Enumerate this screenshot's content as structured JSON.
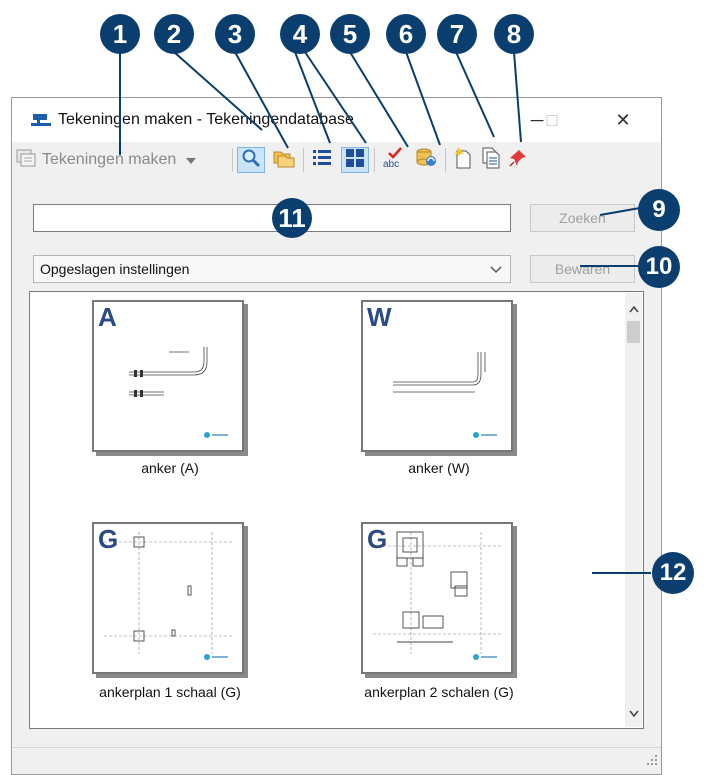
{
  "callouts": [
    "1",
    "2",
    "3",
    "4",
    "5",
    "6",
    "7",
    "8",
    "9",
    "10",
    "11",
    "12"
  ],
  "window": {
    "title": "Tekeningen maken - Tekeningendatabase",
    "minimize_glyph": "─",
    "maximize_glyph": "□",
    "close_glyph": "✕"
  },
  "toolbar": {
    "mode_label": "Tekeningen maken",
    "mode_icon": "drawing-mode-icon",
    "buttons": [
      "search-icon",
      "folders-icon",
      "list-view-icon",
      "thumbnail-view-icon",
      "spellcheck-icon",
      "database-update-icon",
      "new-drawing-icon",
      "copy-drawing-icon",
      "pin-icon"
    ]
  },
  "search": {
    "value": "",
    "button_label": "Zoeken"
  },
  "settings": {
    "selected": "Opgeslagen instellingen",
    "save_label": "Bewaren"
  },
  "gallery": {
    "items": [
      {
        "letter": "A",
        "caption": "anker (A)"
      },
      {
        "letter": "W",
        "caption": "anker (W)"
      },
      {
        "letter": "G",
        "caption": "ankerplan 1 schaal (G)"
      },
      {
        "letter": "G",
        "caption": "ankerplan 2 schalen (G)"
      }
    ]
  },
  "colors": {
    "callout": "#0a3e6e",
    "accent": "#2c4a84",
    "toggle_bg": "#cce4f7"
  }
}
